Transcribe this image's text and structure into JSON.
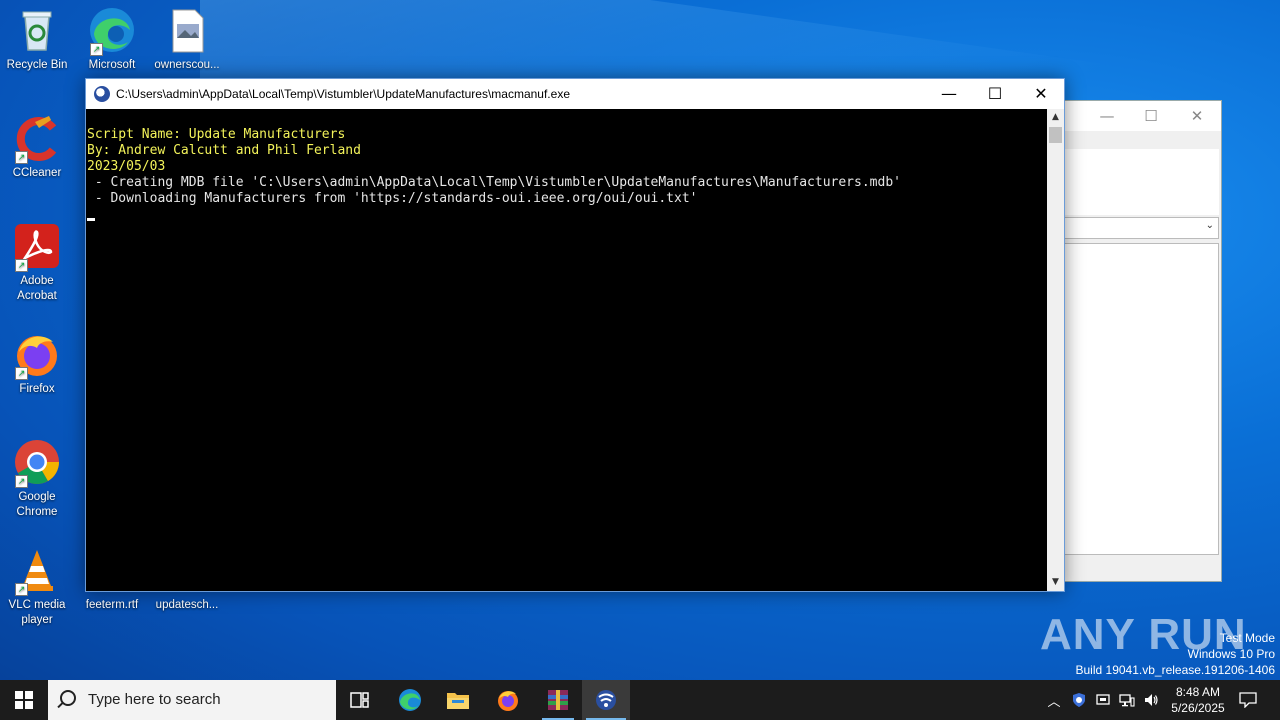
{
  "desktop": {
    "icons": [
      {
        "label": "Recycle Bin"
      },
      {
        "label": "Microsoft Edge"
      },
      {
        "label": "ownerscou..."
      },
      {
        "label": "CCleaner"
      },
      {
        "label": "Adobe Acrobat"
      },
      {
        "label": "Firefox"
      },
      {
        "label": "Google Chrome"
      },
      {
        "label": "VLC media player"
      },
      {
        "label": "feeterm.rtf"
      },
      {
        "label": "updatesch..."
      }
    ]
  },
  "console": {
    "title": "C:\\Users\\admin\\AppData\\Local\\Temp\\Vistumbler\\UpdateManufactures\\macmanuf.exe",
    "lines": [
      "Script Name: Update Manufacturers",
      "By: Andrew Calcutt and Phil Ferland",
      "2023/05/03",
      " - Creating MDB file 'C:\\Users\\admin\\AppData\\Local\\Temp\\Vistumbler\\UpdateManufactures\\Manufacturers.mdb'",
      " - Downloading Manufacturers from 'https://standards-oui.ieee.org/oui/oui.txt'"
    ],
    "minimize": "—",
    "maximize": "☐",
    "close": "✕"
  },
  "watermark": {
    "brand": "ANY RUN",
    "mode": "Test Mode",
    "os": "Windows 10 Pro",
    "build": "Build 19041.vb_release.191206-1406"
  },
  "taskbar": {
    "search_placeholder": "Type here to search",
    "time": "8:48 AM",
    "date": "5/26/2025"
  },
  "colors": {
    "console_bg": "#000000",
    "console_header_text": "#f3f35a",
    "console_text": "#e6e6e6",
    "taskbar_bg": "#1c1c1c"
  }
}
